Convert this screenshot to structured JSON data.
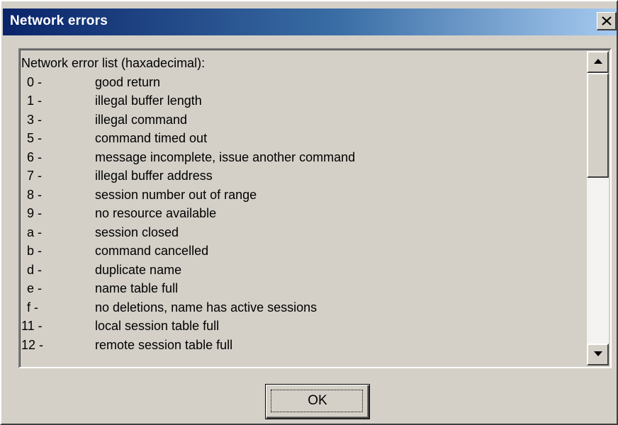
{
  "window": {
    "title": "Network errors",
    "close_icon": "close-icon"
  },
  "list": {
    "header": "Network error list (haxadecimal):",
    "rows": [
      {
        "code": "0 -",
        "desc": "good return"
      },
      {
        "code": "1 -",
        "desc": "illegal buffer length"
      },
      {
        "code": "3 -",
        "desc": "illegal command"
      },
      {
        "code": "5 -",
        "desc": "command timed out"
      },
      {
        "code": "6 -",
        "desc": "message incomplete, issue another command"
      },
      {
        "code": "7 -",
        "desc": "illegal buffer address"
      },
      {
        "code": "8 -",
        "desc": "session number out of range"
      },
      {
        "code": "9 -",
        "desc": "no resource available"
      },
      {
        "code": "a -",
        "desc": "session closed"
      },
      {
        "code": "b -",
        "desc": "command cancelled"
      },
      {
        "code": "d -",
        "desc": "duplicate name"
      },
      {
        "code": "e -",
        "desc": "name table full"
      },
      {
        "code": "f -",
        "desc": "no deletions, name has active sessions"
      },
      {
        "code": "11 -",
        "desc": "local session table full"
      },
      {
        "code": "12 -",
        "desc": "remote session table full"
      }
    ]
  },
  "scrollbar": {
    "up_icon": "arrow-up-icon",
    "down_icon": "arrow-down-icon"
  },
  "buttons": {
    "ok_label": "OK"
  },
  "colors": {
    "titlebar_start": "#0a246a",
    "titlebar_end": "#a6caf0",
    "face": "#d4d0c8"
  }
}
